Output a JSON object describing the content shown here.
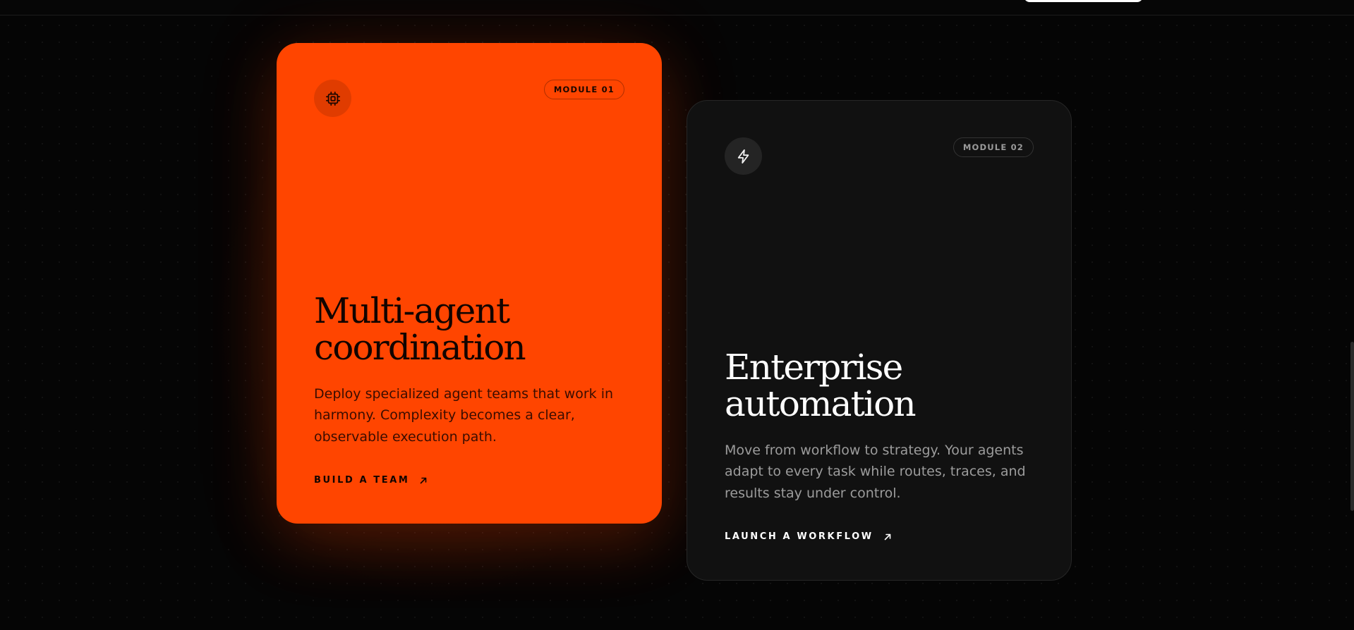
{
  "cards": [
    {
      "module": "MODULE 01",
      "icon": "cpu-chip-icon",
      "title_line1": "Multi-agent",
      "title_line2": "coordination",
      "description": "Deploy specialized agent teams that work in harmony. Complexity becomes a clear, observable execution path.",
      "cta": "BUILD A TEAM",
      "accent": "#ff4500"
    },
    {
      "module": "MODULE 02",
      "icon": "lightning-bolt-icon",
      "title_line1": "Enterprise",
      "title_line2": "automation",
      "description": "Move from workflow to strategy. Your agents adapt to every task while routes, traces, and results stay under control.",
      "cta": "LAUNCH A WORKFLOW",
      "accent": "#111111"
    }
  ]
}
